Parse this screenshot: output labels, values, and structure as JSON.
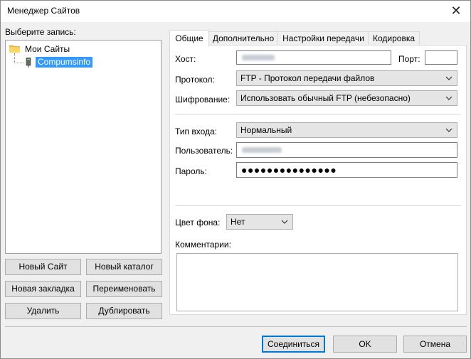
{
  "window": {
    "title": "Менеджер Сайтов",
    "close_icon": "close-icon"
  },
  "left": {
    "select_label": "Выберите запись:",
    "tree": {
      "root_label": "Мои Сайты",
      "root_icon": "folder-icon",
      "site_label": "Compumsinfo",
      "site_icon": "server-icon"
    },
    "buttons": {
      "new_site": "Новый Сайт",
      "new_folder": "Новый каталог",
      "new_bookmark": "Новая закладка",
      "rename": "Переименовать",
      "delete": "Удалить",
      "duplicate": "Дублировать"
    }
  },
  "tabs": [
    {
      "label": "Общие",
      "active": true
    },
    {
      "label": "Дополнительно",
      "active": false
    },
    {
      "label": "Настройки передачи",
      "active": false
    },
    {
      "label": "Кодировка",
      "active": false
    }
  ],
  "general": {
    "host_label": "Хост:",
    "host_value": "",
    "port_label": "Порт:",
    "port_value": "",
    "protocol_label": "Протокол:",
    "protocol_value": "FTP - Протокол передачи файлов",
    "encryption_label": "Шифрование:",
    "encryption_value": "Использовать обычный FTP (небезопасно)",
    "logon_type_label": "Тип входа:",
    "logon_type_value": "Нормальный",
    "user_label": "Пользователь:",
    "user_value": "",
    "password_label": "Пароль:",
    "password_value": "●●●●●●●●●●●●●●●",
    "bg_color_label": "Цвет фона:",
    "bg_color_value": "Нет",
    "comments_label": "Комментарии:",
    "comments_value": ""
  },
  "footer": {
    "connect": "Соединиться",
    "ok": "OK",
    "cancel": "Отмена"
  },
  "colors": {
    "selection": "#3399ff",
    "window_bg": "#f0f0f0",
    "default_button_border": "#0078d7"
  }
}
